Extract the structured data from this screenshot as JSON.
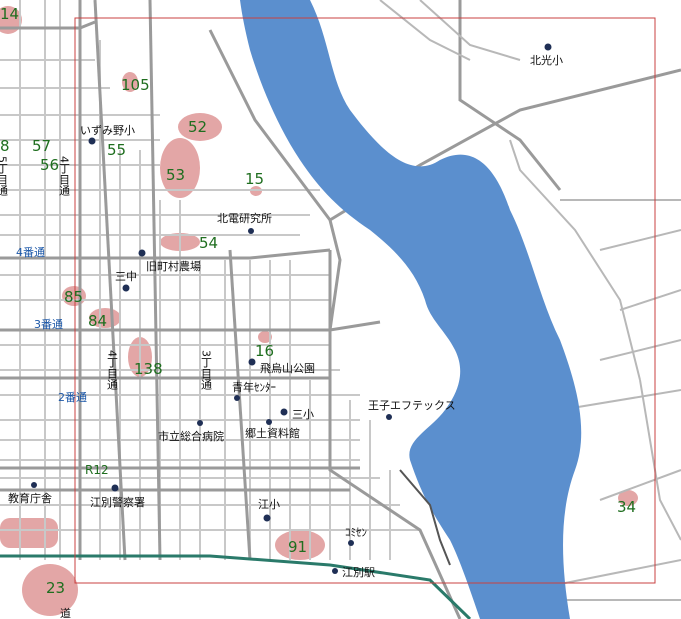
{
  "colors": {
    "river": "#5b8fce",
    "road_major": "#9a9a9a",
    "road_minor": "#c4c4c4",
    "park_area": "#e3a6a6",
    "railway": "#2a7a6a",
    "frame": "#c84040",
    "poi_marker": "#1f2f55"
  },
  "area_numbers": [
    "14",
    "105",
    "52",
    "8",
    "57",
    "55",
    "56",
    "53",
    "15",
    "54",
    "85",
    "84",
    "16",
    "138",
    "91",
    "23",
    "34"
  ],
  "place_labels": [
    "北光小",
    "いずみ野小",
    "北電研究所",
    "旧町村農場",
    "三中",
    "飛烏山公園",
    "青年ｾﾝﾀｰ",
    "三小",
    "王子エフテックス",
    "市立総合病院",
    "郷土資料館",
    "教育庁舎",
    "江別警察署",
    "江小",
    "江別駅",
    "ｺﾐｾﾝ"
  ],
  "street_labels": [
    "4番通",
    "3番通",
    "2番通"
  ],
  "vertical_labels": [
    "5丁目通",
    "4丁目通",
    "4丁目通",
    "3丁目通"
  ],
  "route_label": "R12",
  "corner_glyph": "道"
}
